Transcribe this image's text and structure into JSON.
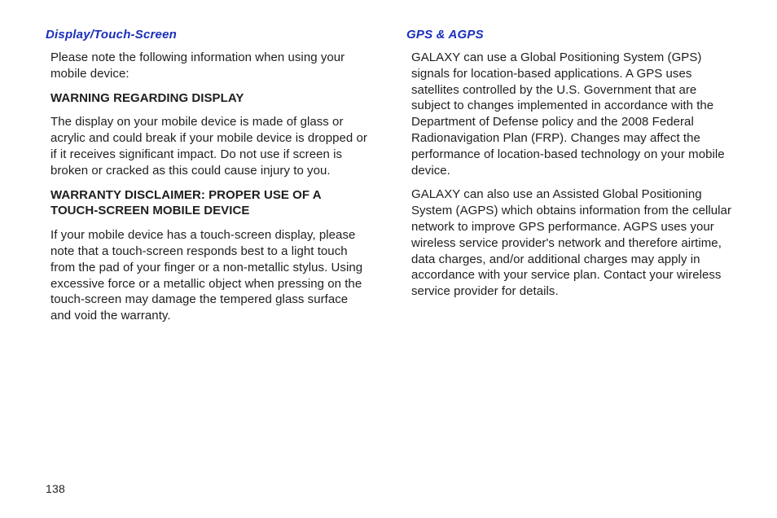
{
  "page_number": "138",
  "left": {
    "heading": "Display/Touch-Screen",
    "intro": "Please note the following information when using your mobile device:",
    "warning_title": "WARNING REGARDING DISPLAY",
    "warning_body": "The display on your mobile device is made of glass or acrylic and could break if your mobile device is dropped or if it receives significant impact.  Do not use if screen is broken or cracked as this could cause injury to you.",
    "warranty_title": "WARRANTY DISCLAIMER: PROPER USE OF A TOUCH-SCREEN MOBILE DEVICE",
    "warranty_body": "If your mobile device has a touch-screen display, please note that a touch-screen responds best to a light touch from the pad of your finger or a non-metallic stylus.  Using excessive force or a metallic object when pressing on the touch-screen may damage the tempered glass surface and void the warranty."
  },
  "right": {
    "heading": "GPS & AGPS",
    "p1": "GALAXY can use a Global Positioning System (GPS) signals for location-based applications.  A GPS uses satellites controlled by the U.S. Government that are subject to changes implemented in accordance with the Department of Defense policy and the 2008 Federal Radionavigation Plan (FRP).  Changes may affect the performance of location-based technology on your mobile device.",
    "p2": "GALAXY can also use an Assisted Global Positioning System (AGPS) which obtains information from the cellular network to improve GPS performance.  AGPS uses your wireless service provider's network and therefore airtime, data charges, and/or additional charges may apply in accordance with your service plan.  Contact your wireless service provider for details."
  }
}
